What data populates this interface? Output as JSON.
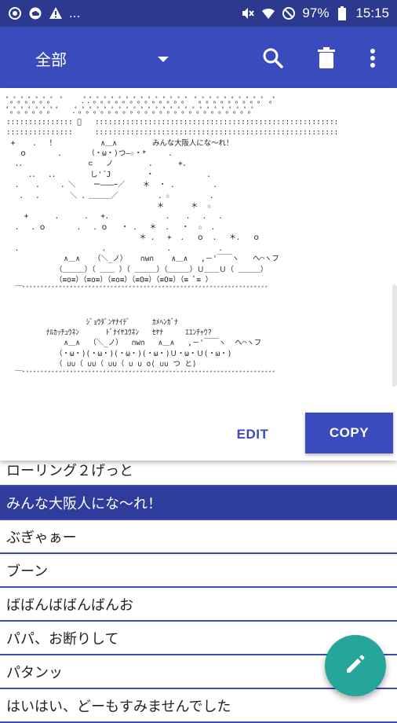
{
  "status_bar": {
    "battery": "97%",
    "time": "15:15",
    "more": "..."
  },
  "app_bar": {
    "category": "全部",
    "icons": [
      "search-icon",
      "trash-icon",
      "more-vert-icon"
    ]
  },
  "preview": {
    "art_lines": [
      "ﾟ｡ﾟ｡ﾟ｡ﾟ｡ﾟ｡ﾟ｡ﾟ  ﾟ    .ﾟ.ﾟ｡ﾟ｡ﾟ｡ﾟ｡ﾟ｡ﾟ｡ﾟ｡ﾟ｡ﾟ｡ﾟ｡ﾟ｡ﾟ｡ﾟ｡ﾟ  ﾟ｡ﾟ｡ﾟ｡ﾟ｡ﾟ｡ﾟ｡ﾟ｡ﾟ｡ﾟ｡ﾟ ｡ﾟ",
      "ﾟ｡ﾟ｡ﾟ｡ﾟ｡ﾟ｡ﾟ｡ﾟ ﾟ   .ﾟ｡ﾟ｡ﾟ｡ﾟ｡ﾟ｡ﾟ｡ﾟ｡ﾟ｡ﾟ｡ﾟ｡ﾟ｡ﾟ｡ﾟ｡ﾟ｡ﾟ｡ﾟ｡ﾟ｡ﾟ｡ﾟ｡ﾟ｡ﾟ｡ﾟ｡ﾟ｡ﾟ｡ﾟ",
      "::::::::::::::: ﾟ   :::::::::::::::::::::::::::::::::::::::::::::::::::::::",
      ":::::::::::::::     :::::::::::::::::::::::::::::::::::::::::::::::::::::::",
      " +    ．  ！          ∧＿∧        みんな大阪人にな～れ！",
      "   ｏ       ．     （・ω・)つ―☆・*     ．",
      "  ．．              ⊂   ノ        ．     +．",
      "     ．．  ．．       し'´J        ・            ．",
      "  ．   ．    ．＼    ー―――ｰ／    ＊  ・ ．        ．",
      "   ．  ．      ＼ ．＿＿＿／         ．☆         ．",
      "                                  ＊      ＊  ☆",
      "    +      ．     ．  +．            ．   ．  ．  ．",
      "  ．  ．ｏ       ．  ．ｏ   ・ ．  ＊  ．  ・  ☆  ．",
      "                              ＊ ．  +  ．  ｏ  ．  ＊．  ｏ",
      "  ．                  ．             ．          ．",
      "             ∧＿∧   （＼_ノ）   ∩w∩    ∧＿∧   ,－'￣￣ヽ   ヘ⌒ヽフ",
      "           （＿＿＿）（ ＿＿ ）（ ＿＿＿）（＿＿＿）Ｕ＿＿Ｕ（ ＿＿＿）",
      "           （≡o≡）（≡o≡）（≡o≡）（≡O≡）（≡O≡）（≡ ﾟ≡ ）",
      "  ￣ﾞﾞﾞﾞﾞﾞﾞﾞﾞﾞﾞﾞﾞﾞﾞﾞﾞﾞﾞﾞﾞﾞﾞﾞﾞﾞﾞﾞﾞﾞﾞﾞﾞﾞﾞﾞﾞﾞﾞﾞﾞﾞﾞﾞﾞﾞﾞﾞﾞﾞﾞﾞﾞﾞﾞﾞﾞﾞﾞﾞﾞﾞﾞﾞﾞﾞﾞ",
      "",
      "",
      "                  ｼﾞｮｳﾀﾞﾝﾔﾅｲﾃﾞ     ｶﾒﾍﾝｶﾞﾅ",
      "         ﾅﾙｶｯﾁｭｳﾈﾝ      ﾄﾞﾅｲﾔﾕｳﾈﾝ   ｾﾔﾅ     ｴｴﾝﾁｬｳ?",
      "             ∧＿∧  （＼_ノ）  ∩w∩   ∧＿∧   ,－'￣￣ヽ  ヘ⌒ヽフ",
      "           （・ω・)(・ω・)(・ω・)(・ω・)Ｕ・ω・Ｕ(・ω・)",
      "           （ ∪∪（ ∪∪（ ∪∪（ ∪ ∪ o( ∪∪ つ と)",
      "  ￣ﾞﾞﾞﾞﾞﾞﾞﾞﾞﾞﾞﾞﾞﾞﾞﾞﾞﾞﾞﾞﾞﾞﾞﾞﾞﾞﾞﾞﾞﾞﾞﾞﾞﾞﾞﾞﾞﾞﾞﾞﾞﾞﾞﾞﾞﾞﾞﾞﾞﾞﾞﾞﾞﾞﾞﾞﾞﾞﾞﾞﾞﾞﾞﾞﾞﾞﾞﾞﾞ"
    ],
    "edit_label": "EDIT",
    "copy_label": "COPY"
  },
  "list": {
    "items": [
      "ローリング２げっと",
      "みんな大阪人にな～れ！",
      "ぶぎゃぁー",
      "ブーン",
      "ばばんばばんばんお",
      "パパ、お断りして",
      "パタンッ",
      "はいはい、どーもすみませんでした"
    ],
    "selected_index": 1
  },
  "colors": {
    "status_bar": "#2b3a8f",
    "app_bar": "#3a4bbd",
    "selected_row": "#2e3d9c",
    "fab": "#26a69a"
  },
  "fab": {
    "icon": "pencil-icon"
  }
}
